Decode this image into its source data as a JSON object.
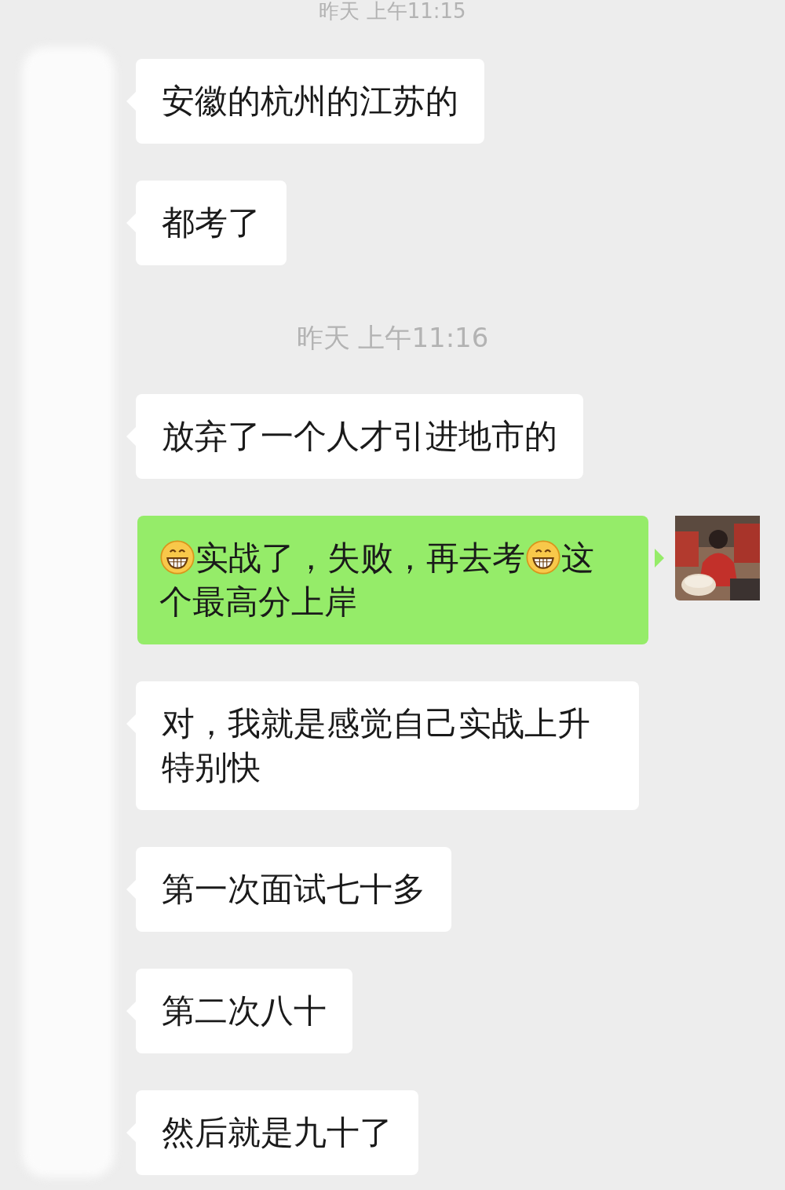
{
  "messages": [
    {
      "kind": "time",
      "text": "昨天 上午11:15"
    },
    {
      "kind": "received",
      "parts": [
        {
          "kind": "text",
          "text": "安徽的杭州的江苏的"
        }
      ]
    },
    {
      "kind": "received",
      "parts": [
        {
          "kind": "text",
          "text": "都考了"
        }
      ]
    },
    {
      "kind": "time",
      "text": "昨天 上午11:16"
    },
    {
      "kind": "received",
      "parts": [
        {
          "kind": "text",
          "text": "放弃了一个人才引进地市的"
        }
      ]
    },
    {
      "kind": "sent",
      "parts": [
        {
          "kind": "emoji"
        },
        {
          "kind": "text",
          "text": "实战了，失败，再去考"
        },
        {
          "kind": "emoji"
        },
        {
          "kind": "text",
          "text": "这个最高分上岸"
        }
      ]
    },
    {
      "kind": "received",
      "parts": [
        {
          "kind": "text",
          "text": "对，我就是感觉自己实战上升特别快"
        }
      ]
    },
    {
      "kind": "received",
      "parts": [
        {
          "kind": "text",
          "text": "第一次面试七十多"
        }
      ]
    },
    {
      "kind": "received",
      "parts": [
        {
          "kind": "text",
          "text": "第二次八十"
        }
      ]
    },
    {
      "kind": "received",
      "parts": [
        {
          "kind": "text",
          "text": "然后就是九十了"
        }
      ]
    }
  ]
}
